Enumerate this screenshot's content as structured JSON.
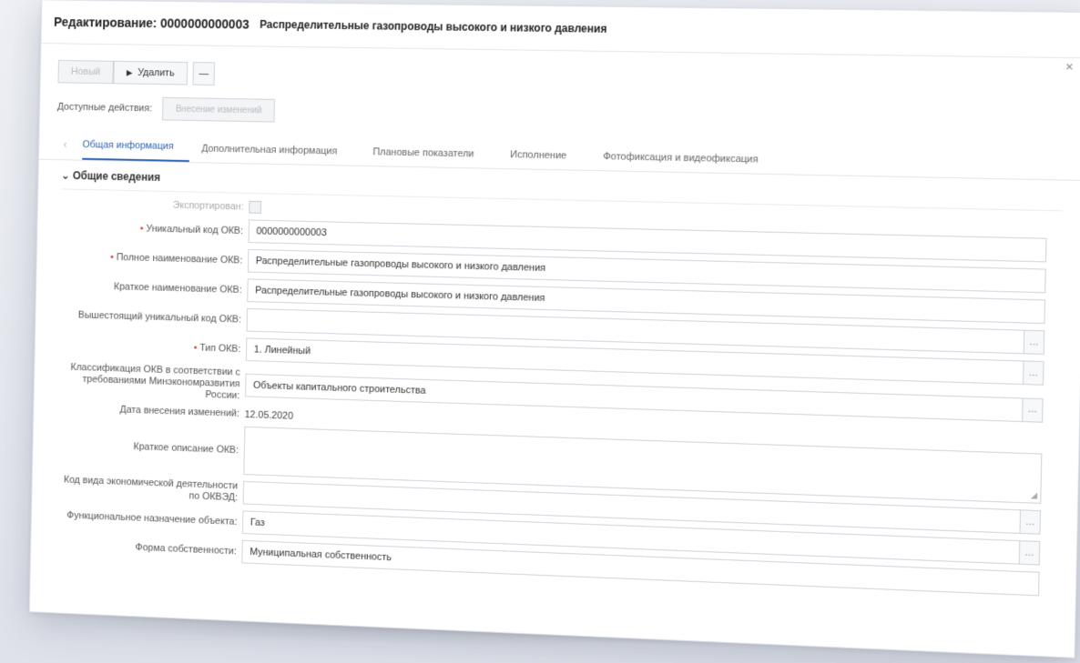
{
  "window": {
    "title_prefix": "Редактирование:",
    "code": "0000000000003",
    "name": "Распределительные газопроводы высокого и низкого давления",
    "close": "×"
  },
  "toolbar": {
    "new_label": "Новый",
    "delete_label": "Удалить",
    "more_label": "—"
  },
  "actions": {
    "label": "Доступные действия:",
    "button_label": "Внесение изменений"
  },
  "tabs": [
    {
      "label": "Общая информация",
      "active": true
    },
    {
      "label": "Дополнительная информация",
      "active": false
    },
    {
      "label": "Плановые показатели",
      "active": false
    },
    {
      "label": "Исполнение",
      "active": false
    },
    {
      "label": "Фотофиксация и видеофиксация",
      "active": false
    }
  ],
  "section": {
    "title": "Общие сведения"
  },
  "fields": {
    "exported": {
      "label": "Экспортирован:"
    },
    "unique_code": {
      "label": "Уникальный код ОКВ:",
      "value": "0000000000003"
    },
    "full_name": {
      "label": "Полное наименование ОКВ:",
      "value": "Распределительные газопроводы высокого и низкого давления"
    },
    "short_name": {
      "label": "Краткое наименование ОКВ:",
      "value": "Распределительные газопроводы высокого и низкого давления"
    },
    "parent_code": {
      "label": "Вышестоящий уникальный код ОКВ:",
      "value": ""
    },
    "type": {
      "label": "Тип ОКВ:",
      "value": "1. Линейный"
    },
    "classification": {
      "label": "Классификация ОКВ в соответствии с требованиями Минэкономразвития России:",
      "value": "Объекты капитального строительства"
    },
    "change_date": {
      "label": "Дата внесения изменений:",
      "value": "12.05.2020"
    },
    "description": {
      "label": "Краткое описание ОКВ:",
      "value": ""
    },
    "okved": {
      "label": "Код вида экономической деятельности по ОКВЭД:",
      "value": ""
    },
    "purpose": {
      "label": "Функциональное назначение объекта:",
      "value": "Газ"
    },
    "ownership": {
      "label": "Форма собственности:",
      "value": "Муниципальная собственность"
    }
  }
}
